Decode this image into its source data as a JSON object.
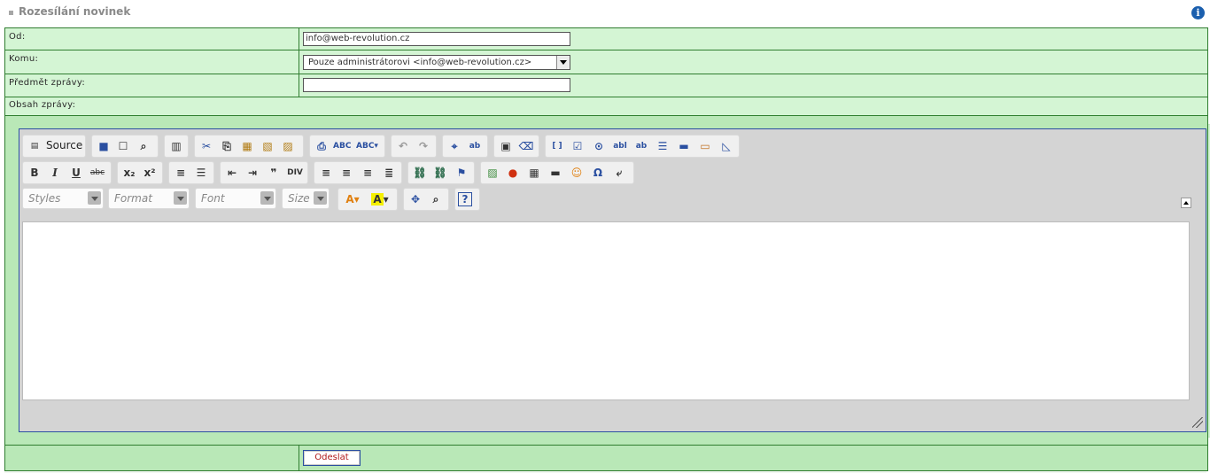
{
  "header": {
    "title": "Rozesílání novinek",
    "info_icon": "i"
  },
  "form": {
    "from_label": "Od:",
    "from_value": "info@web-revolution.cz",
    "to_label": "Komu:",
    "to_value": "Pouze administrátorovi <info@web-revolution.cz>",
    "subject_label": "Předmět zprávy:",
    "subject_value": "",
    "body_label": "Obsah zprávy:",
    "submit_label": "Odeslat"
  },
  "editor": {
    "source_label": "Source",
    "combos": {
      "styles": "Styles",
      "format": "Format",
      "font": "Font",
      "size": "Size"
    },
    "glyphs": {
      "bold": "B",
      "italic": "I",
      "underline": "U",
      "strike": "abc",
      "subscript": "x₂",
      "superscript": "x²",
      "omega": "Ω",
      "help": "?"
    }
  },
  "colors": {
    "row_bg": "#d4f5d4",
    "frame_bg": "#b9e8b7",
    "border": "#2f7d2f",
    "editor_border": "#2a4fa0",
    "submit_text": "#b01818"
  }
}
